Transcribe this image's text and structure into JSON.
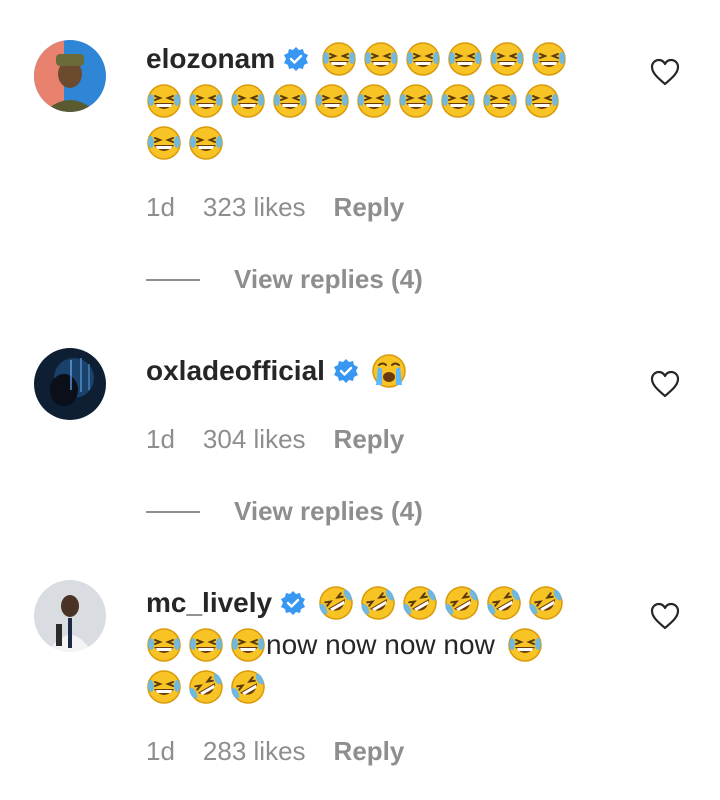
{
  "comments": [
    {
      "username": "elozonam",
      "verified": true,
      "time": "1d",
      "likes": "323 likes",
      "reply_label": "Reply",
      "view_replies": "View replies (4)"
    },
    {
      "username": "oxladeofficial",
      "verified": true,
      "time": "1d",
      "likes": "304 likes",
      "reply_label": "Reply",
      "view_replies": "View replies (4)"
    },
    {
      "username": "mc_lively",
      "verified": true,
      "text_inline": "now now now now",
      "time": "1d",
      "likes": "283 likes",
      "reply_label": "Reply"
    }
  ],
  "icons": {
    "verified": "verified-badge-icon",
    "heart": "heart-outline-icon",
    "emoji_grin": "grinning-squinting-sweat-emoji",
    "emoji_cry": "loudly-crying-emoji",
    "emoji_rofl": "rolling-on-floor-laughing-emoji"
  },
  "colors": {
    "verified_blue": "#3897f0",
    "muted_text": "#8e8e8e",
    "emoji_yellow": "#f7c325"
  }
}
